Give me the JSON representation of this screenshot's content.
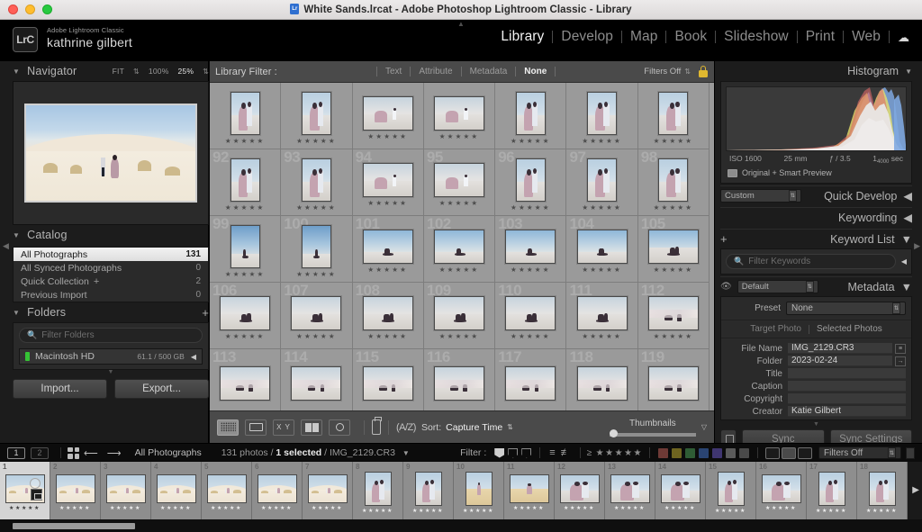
{
  "window": {
    "title": "White Sands.lrcat - Adobe Photoshop Lightroom Classic - Library",
    "app_icon": "lightroom-icon"
  },
  "identity": {
    "badge": "LrC",
    "app_name": "Adobe Lightroom Classic",
    "user_name": "kathrine gilbert"
  },
  "modules": {
    "items": [
      {
        "label": "Library",
        "active": true
      },
      {
        "label": "Develop",
        "active": false
      },
      {
        "label": "Map",
        "active": false
      },
      {
        "label": "Book",
        "active": false
      },
      {
        "label": "Slideshow",
        "active": false
      },
      {
        "label": "Print",
        "active": false
      },
      {
        "label": "Web",
        "active": false
      }
    ],
    "cloud_icon": "cloud-icon"
  },
  "left_panel": {
    "navigator": {
      "title": "Navigator",
      "fit": "FIT",
      "hundred": "100%",
      "zoom": "25%"
    },
    "catalog": {
      "title": "Catalog",
      "rows": [
        {
          "name": "All Photographs",
          "count": "131",
          "selected": true
        },
        {
          "name": "All Synced Photographs",
          "count": "0",
          "selected": false
        },
        {
          "name": "Quick Collection",
          "count": "2",
          "selected": false,
          "plus": "+"
        },
        {
          "name": "Previous Import",
          "count": "0",
          "selected": false
        }
      ]
    },
    "folders": {
      "title": "Folders",
      "add": "+",
      "filter_placeholder": "Filter Folders",
      "volume": {
        "name": "Macintosh HD",
        "space": "61.1 / 500 GB"
      }
    },
    "buttons": {
      "import": "Import...",
      "export": "Export..."
    }
  },
  "library_filter": {
    "label": "Library Filter :",
    "tabs": [
      {
        "label": "Text",
        "active": false
      },
      {
        "label": "Attribute",
        "active": false
      },
      {
        "label": "Metadata",
        "active": false
      },
      {
        "label": "None",
        "active": true
      }
    ],
    "filters_off": "Filters Off",
    "lock_icon": "lock-icon"
  },
  "grid": {
    "rows": [
      {
        "cells": [
          {
            "index": "",
            "orient": "port",
            "sky": "sky-a",
            "stars": "★★★★★",
            "scene": "couple-embrace"
          },
          {
            "index": "",
            "orient": "port",
            "sky": "sky-a",
            "stars": "★★★★★",
            "scene": "couple-embrace"
          },
          {
            "index": "",
            "orient": "land",
            "sky": "sky-d",
            "stars": "★★★★★",
            "scene": "couple-walk"
          },
          {
            "index": "",
            "orient": "land",
            "sky": "sky-d",
            "stars": "★★★★★",
            "scene": "couple-walk"
          },
          {
            "index": "",
            "orient": "port",
            "sky": "sky-a",
            "stars": "★★★★★",
            "scene": "couple-embrace"
          },
          {
            "index": "",
            "orient": "port",
            "sky": "sky-a",
            "stars": "★★★★★",
            "scene": "couple-embrace"
          },
          {
            "index": "",
            "orient": "port",
            "sky": "sky-a",
            "stars": "★★★★★",
            "scene": "couple-embrace"
          }
        ]
      },
      {
        "cells": [
          {
            "index": "92",
            "orient": "port",
            "sky": "sky-a",
            "stars": "★★★★★",
            "scene": "couple-embrace"
          },
          {
            "index": "93",
            "orient": "port",
            "sky": "sky-a",
            "stars": "★★★★★",
            "scene": "couple-embrace"
          },
          {
            "index": "94",
            "orient": "land",
            "sky": "sky-d",
            "stars": "★★★★★",
            "scene": "couple-walk"
          },
          {
            "index": "95",
            "orient": "land",
            "sky": "sky-d",
            "stars": "★★★★★",
            "scene": "couple-walk"
          },
          {
            "index": "96",
            "orient": "port",
            "sky": "sky-a",
            "stars": "★★★★★",
            "scene": "couple-embrace"
          },
          {
            "index": "97",
            "orient": "port",
            "sky": "sky-a",
            "stars": "★★★★★",
            "scene": "couple-embrace"
          },
          {
            "index": "98",
            "orient": "port",
            "sky": "sky-a",
            "stars": "★★★★★",
            "scene": "couple-embrace"
          }
        ]
      },
      {
        "cells": [
          {
            "index": "99",
            "orient": "port",
            "sky": "sky-c",
            "stars": "★★★★★",
            "scene": "solo-dune"
          },
          {
            "index": "100",
            "orient": "port",
            "sky": "sky-c",
            "stars": "★★★★★",
            "scene": "solo-dune"
          },
          {
            "index": "101",
            "orient": "land",
            "sky": "sky-b",
            "stars": "★★★★★",
            "scene": "solo-dune"
          },
          {
            "index": "102",
            "orient": "land",
            "sky": "sky-b",
            "stars": "★★★★★",
            "scene": "solo-dune"
          },
          {
            "index": "103",
            "orient": "land",
            "sky": "sky-b",
            "stars": "★★★★★",
            "scene": "solo-dune"
          },
          {
            "index": "104",
            "orient": "land",
            "sky": "sky-b",
            "stars": "★★★★★",
            "scene": "solo-dune"
          },
          {
            "index": "105",
            "orient": "land",
            "sky": "sky-b",
            "stars": "★★★★★",
            "scene": "couple-sit"
          }
        ]
      },
      {
        "cells": [
          {
            "index": "106",
            "orient": "land",
            "sky": "sky-d",
            "stars": "★★★★★",
            "scene": "couple-sit"
          },
          {
            "index": "107",
            "orient": "land",
            "sky": "sky-d",
            "stars": "★★★★★",
            "scene": "couple-sit"
          },
          {
            "index": "108",
            "orient": "land",
            "sky": "sky-d",
            "stars": "★★★★★",
            "scene": "couple-sit"
          },
          {
            "index": "109",
            "orient": "land",
            "sky": "sky-d",
            "stars": "★★★★★",
            "scene": "couple-sit"
          },
          {
            "index": "110",
            "orient": "land",
            "sky": "sky-d",
            "stars": "★★★★★",
            "scene": "couple-sit"
          },
          {
            "index": "111",
            "orient": "land",
            "sky": "sky-d",
            "stars": "★★★★★",
            "scene": "couple-sit"
          },
          {
            "index": "112",
            "orient": "land",
            "sky": "sky-d",
            "stars": "★★★★★",
            "scene": "dress-lay"
          }
        ]
      },
      {
        "cells": [
          {
            "index": "113",
            "orient": "land",
            "sky": "sky-d",
            "stars": "",
            "scene": "dress-lay"
          },
          {
            "index": "114",
            "orient": "land",
            "sky": "sky-d",
            "stars": "",
            "scene": "dress-lay"
          },
          {
            "index": "115",
            "orient": "land",
            "sky": "sky-d",
            "stars": "",
            "scene": "dress-lay"
          },
          {
            "index": "116",
            "orient": "land",
            "sky": "sky-d",
            "stars": "",
            "scene": "dress-lay"
          },
          {
            "index": "117",
            "orient": "land",
            "sky": "sky-d",
            "stars": "",
            "scene": "dress-lay"
          },
          {
            "index": "118",
            "orient": "land",
            "sky": "sky-d",
            "stars": "",
            "scene": "dress-lay"
          },
          {
            "index": "119",
            "orient": "land",
            "sky": "sky-d",
            "stars": "",
            "scene": "dress-lay"
          }
        ]
      }
    ]
  },
  "grid_toolbar": {
    "view_icons": [
      {
        "name": "grid-view-icon",
        "active": true
      },
      {
        "name": "loupe-view-icon",
        "active": false
      },
      {
        "name": "compare-view-icon",
        "active": false,
        "glyph": "X|Y"
      },
      {
        "name": "survey-view-icon",
        "active": false
      },
      {
        "name": "people-view-icon",
        "active": false
      }
    ],
    "spray_icon": "spray-can-icon",
    "sort_icon": "sort-az-icon",
    "sort_label": "Sort:",
    "sort_value": "Capture Time",
    "thumbnails_label": "Thumbnails",
    "thumbnails_value": 6,
    "caret_icon": "chevron-down-icon"
  },
  "right_panel": {
    "histogram": {
      "title": "Histogram",
      "iso": "ISO 1600",
      "focal": "25 mm",
      "aperture": "ƒ / 3.5",
      "shutter_num": "1",
      "shutter_den": "4000",
      "shutter_suffix": "sec",
      "preview_status": "Original + Smart Preview"
    },
    "quick_develop": {
      "title": "Quick Develop",
      "preset": "Custom"
    },
    "keywording": {
      "title": "Keywording"
    },
    "keyword_list": {
      "title": "Keyword List",
      "add": "+",
      "filter_placeholder": "Filter Keywords"
    },
    "metadata": {
      "title": "Metadata",
      "view": "Default",
      "preset_label": "Preset",
      "preset_value": "None",
      "target_tab": "Target Photo",
      "selected_tab": "Selected Photos",
      "fields": [
        {
          "key": "File Name",
          "value": "IMG_2129.CR3",
          "action": "list-icon"
        },
        {
          "key": "Folder",
          "value": "2023-02-24",
          "action": "goto-icon"
        },
        {
          "key": "Title",
          "value": "",
          "action": ""
        },
        {
          "key": "Caption",
          "value": "",
          "action": ""
        },
        {
          "key": "Copyright",
          "value": "",
          "action": ""
        },
        {
          "key": "Creator",
          "value": "Katie Gilbert",
          "action": ""
        }
      ]
    },
    "sync": {
      "button": "Sync",
      "settings": "Sync Settings"
    }
  },
  "filmstrip_header": {
    "screen_buttons": [
      "1",
      "2"
    ],
    "grid_icon": "grid-view-icon",
    "back_icon": "arrow-left-icon",
    "forward_icon": "arrow-right-icon",
    "source": "All Photographs",
    "photo_count": "131 photos /",
    "selected": "1 selected",
    "current_file": "/ IMG_2129.CR3",
    "filter_label": "Filter :",
    "stars": "★★★★★",
    "gte": "≥",
    "color_swatches": [
      "#6e3a36",
      "#6e6420",
      "#2f5c35",
      "#2a4472",
      "#3f3570",
      "#5a5a5a",
      "#4a4a4a"
    ],
    "filters_off": "Filters Off"
  },
  "filmstrip": {
    "cells": [
      {
        "index": "1",
        "orient": "land",
        "sky": "sky-a",
        "stars": "★★★★★",
        "selected": true,
        "scene": "couple-dune"
      },
      {
        "index": "2",
        "orient": "land",
        "sky": "sky-a",
        "stars": "★★★★★",
        "selected": false,
        "scene": "couple-dune"
      },
      {
        "index": "3",
        "orient": "land",
        "sky": "sky-a",
        "stars": "★★★★★",
        "selected": false,
        "scene": "couple-dune"
      },
      {
        "index": "4",
        "orient": "land",
        "sky": "sky-a",
        "stars": "★★★★★",
        "selected": false,
        "scene": "couple-dune"
      },
      {
        "index": "5",
        "orient": "land",
        "sky": "sky-a",
        "stars": "★★★★★",
        "selected": false,
        "scene": "couple-dune"
      },
      {
        "index": "6",
        "orient": "land",
        "sky": "sky-a",
        "stars": "★★★★★",
        "selected": false,
        "scene": "couple-dune"
      },
      {
        "index": "7",
        "orient": "land",
        "sky": "sky-a",
        "stars": "★★★★★",
        "selected": false,
        "scene": "couple-dune"
      },
      {
        "index": "8",
        "orient": "port",
        "sky": "sky-a",
        "stars": "★★★★★",
        "selected": false,
        "scene": "couple-embrace"
      },
      {
        "index": "9",
        "orient": "port",
        "sky": "sky-a",
        "stars": "★★★★★",
        "selected": false,
        "scene": "couple-embrace"
      },
      {
        "index": "10",
        "orient": "port",
        "sky": "sky-a",
        "stars": "★★★★★",
        "selected": false,
        "scene": "grass-solo"
      },
      {
        "index": "11",
        "orient": "land",
        "sky": "sky-a",
        "stars": "★★★★★",
        "selected": false,
        "scene": "grass-solo"
      },
      {
        "index": "12",
        "orient": "land",
        "sky": "sky-a",
        "stars": "★★★★★",
        "selected": false,
        "scene": "couple-embrace"
      },
      {
        "index": "13",
        "orient": "land",
        "sky": "sky-a",
        "stars": "★★★★★",
        "selected": false,
        "scene": "couple-embrace"
      },
      {
        "index": "14",
        "orient": "land",
        "sky": "sky-a",
        "stars": "★★★★★",
        "selected": false,
        "scene": "couple-embrace"
      },
      {
        "index": "15",
        "orient": "port",
        "sky": "sky-a",
        "stars": "★★★★★",
        "selected": false,
        "scene": "couple-embrace"
      },
      {
        "index": "16",
        "orient": "land",
        "sky": "sky-a",
        "stars": "★★★★★",
        "selected": false,
        "scene": "couple-embrace"
      },
      {
        "index": "17",
        "orient": "port",
        "sky": "sky-a",
        "stars": "★★★★★",
        "selected": false,
        "scene": "couple-embrace"
      },
      {
        "index": "18",
        "orient": "port",
        "sky": "sky-a",
        "stars": "★★★★★",
        "selected": false,
        "scene": "couple-embrace"
      }
    ]
  }
}
